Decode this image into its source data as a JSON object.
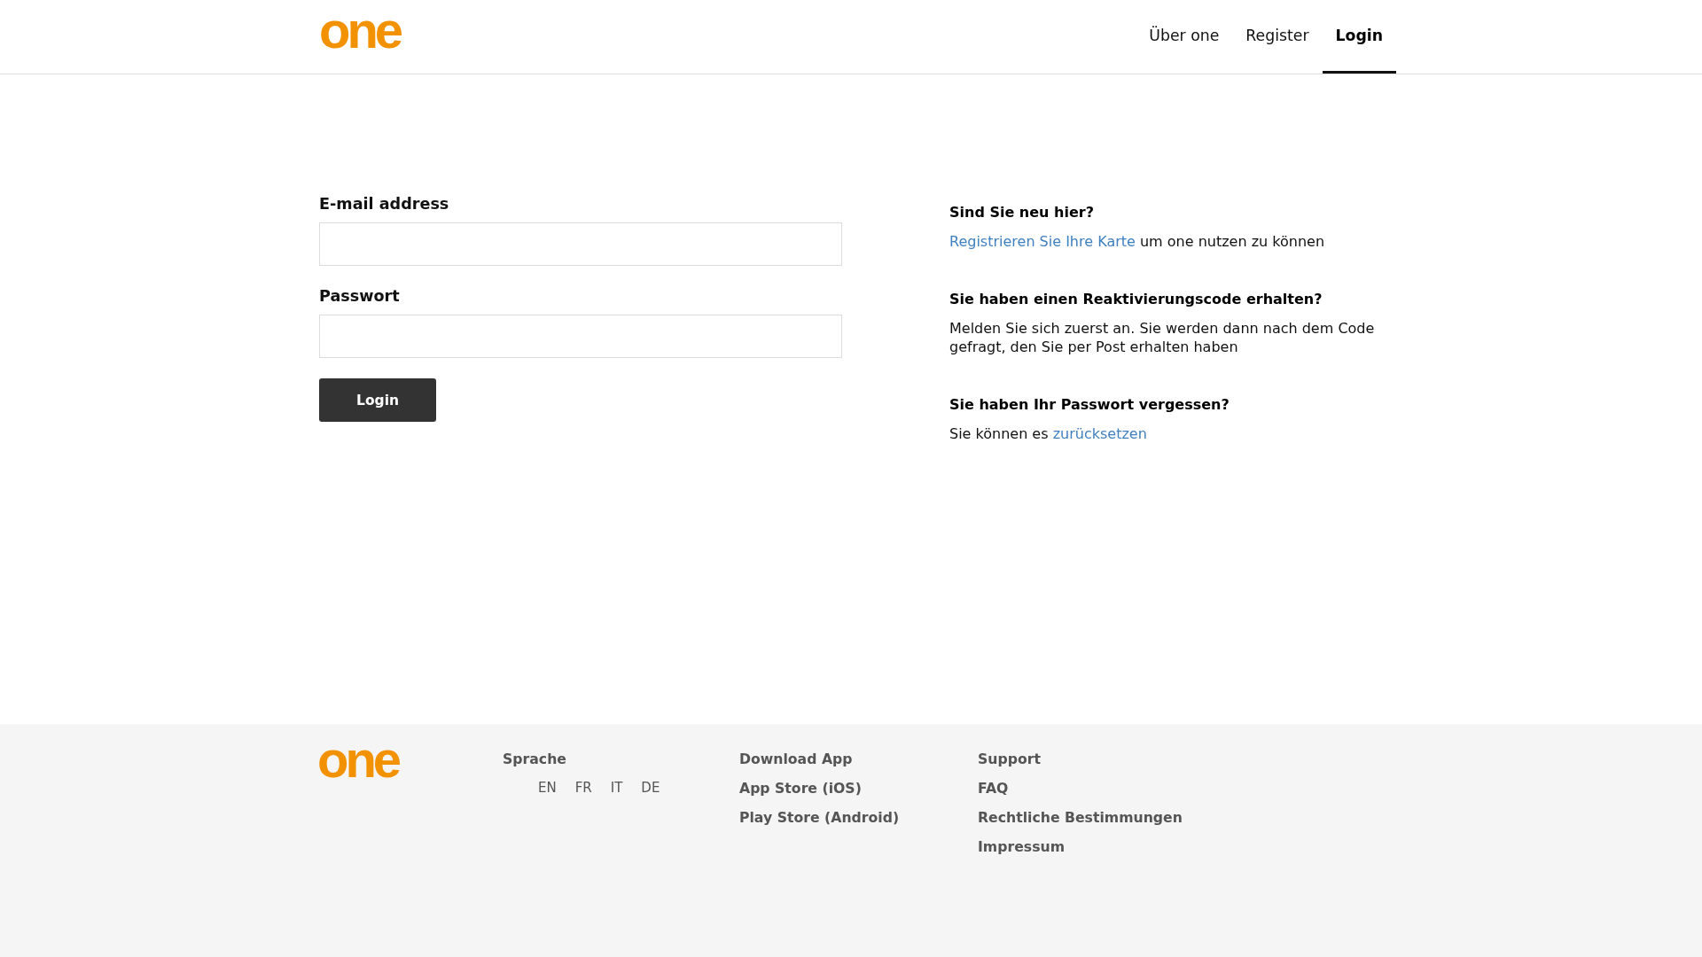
{
  "header": {
    "logo": "one",
    "nav": [
      {
        "label": "Über one",
        "selected": false
      },
      {
        "label": "Register",
        "selected": false
      },
      {
        "label": "Login",
        "selected": true
      }
    ]
  },
  "login_form": {
    "fields": [
      {
        "label": "E-mail address"
      },
      {
        "label": "Passwort"
      }
    ],
    "submit": "Login"
  },
  "help": [
    {
      "title": "Sind Sie neu hier?",
      "parts": [
        {
          "kind": "link",
          "text": "Registrieren Sie Ihre Karte"
        },
        {
          "kind": "text",
          "text": "um one nutzen zu können"
        }
      ]
    },
    {
      "title": "Sie haben einen Reaktivierungscode erhalten?",
      "parts": [
        {
          "kind": "text",
          "text": "Melden Sie sich zuerst an. Sie werden dann nach dem Code gefragt, den Sie per Post erhalten haben"
        }
      ]
    },
    {
      "title": "Sie haben Ihr Passwort vergessen?",
      "parts": [
        {
          "kind": "text",
          "text": "Sie können es"
        },
        {
          "kind": "link",
          "text": "zurücksetzen"
        }
      ]
    }
  ],
  "footer": {
    "logo": "one",
    "columns": [
      {
        "title": "Sprache",
        "kind": "languages",
        "items": [
          "EN",
          "FR",
          "IT",
          "DE"
        ]
      },
      {
        "title": "Download App",
        "kind": "links",
        "items": [
          "App Store (iOS)",
          "Play Store (Android)"
        ]
      },
      {
        "title": "Support",
        "kind": "links",
        "items": [
          "FAQ",
          "Rechtliche Bestimmungen",
          "Impressum"
        ]
      }
    ]
  }
}
